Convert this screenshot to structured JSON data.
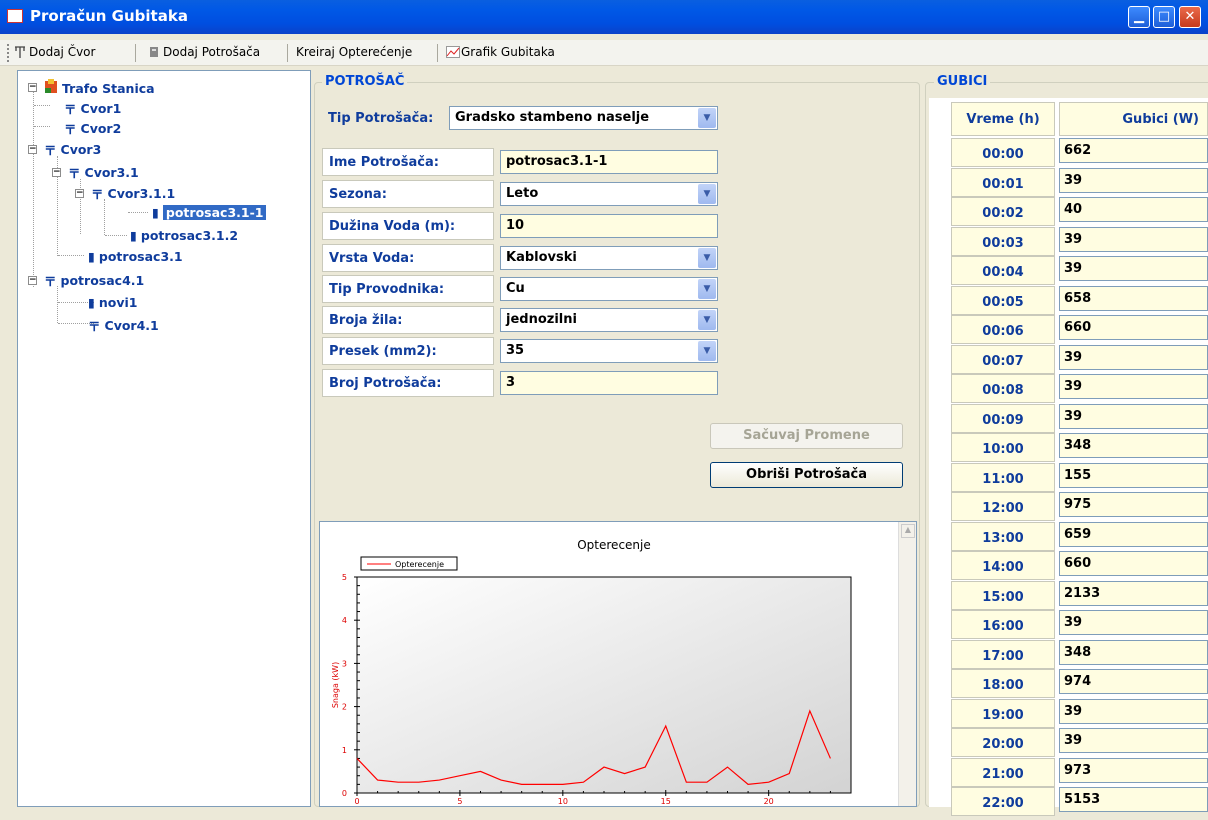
{
  "window": {
    "title": "Proračun Gubitaka"
  },
  "toolbar": {
    "add_node": "Dodaj Čvor",
    "add_consumer": "Dodaj Potrošača",
    "create_load": "Kreiraj Opterećenje",
    "loss_chart": "Grafik Gubitaka"
  },
  "tree": {
    "root": "Trafo Stanica",
    "cvor1": "Cvor1",
    "cvor2": "Cvor2",
    "cvor3": "Cvor3",
    "cvor31": "Cvor3.1",
    "cvor311": "Cvor3.1.1",
    "p3111": "potrosac3.1-1",
    "p312": "potrosac3.1.2",
    "p31": "potrosac3.1",
    "p41": "potrosac4.1",
    "novi1": "novi1",
    "cvor41": "Cvor4.1"
  },
  "consumer": {
    "group_title": "POTROŠAČ",
    "type_label": "Tip Potrošača:",
    "type_value": "Gradsko stambeno naselje",
    "fields": [
      {
        "label": "Ime Potrošača:",
        "value": "potrosac3.1-1"
      },
      {
        "label": "Sezona:",
        "value": "Leto"
      },
      {
        "label": "Dužina Voda (m):",
        "value": "10"
      },
      {
        "label": "Vrsta Voda:",
        "value": "Kablovski"
      },
      {
        "label": "Tip Provodnika:",
        "value": "Cu"
      },
      {
        "label": "Broja žila:",
        "value": "jednozilni"
      },
      {
        "label": "Presek (mm2):",
        "value": "35"
      },
      {
        "label": "Broj Potrošača:",
        "value": "3"
      }
    ],
    "save_button": "Sačuvaj Promene",
    "delete_button": "Obriši Potrošača"
  },
  "losses": {
    "group_title": "GUBICI",
    "col_time": "Vreme (h)",
    "col_loss": "Gubici (W)",
    "rows": [
      {
        "time": "00:00",
        "loss": "662"
      },
      {
        "time": "00:01",
        "loss": "39"
      },
      {
        "time": "00:02",
        "loss": "40"
      },
      {
        "time": "00:03",
        "loss": "39"
      },
      {
        "time": "00:04",
        "loss": "39"
      },
      {
        "time": "00:05",
        "loss": "658"
      },
      {
        "time": "00:06",
        "loss": "660"
      },
      {
        "time": "00:07",
        "loss": "39"
      },
      {
        "time": "00:08",
        "loss": "39"
      },
      {
        "time": "00:09",
        "loss": "39"
      },
      {
        "time": "10:00",
        "loss": "348"
      },
      {
        "time": "11:00",
        "loss": "155"
      },
      {
        "time": "12:00",
        "loss": "975"
      },
      {
        "time": "13:00",
        "loss": "659"
      },
      {
        "time": "14:00",
        "loss": "660"
      },
      {
        "time": "15:00",
        "loss": "2133"
      },
      {
        "time": "16:00",
        "loss": "39"
      },
      {
        "time": "17:00",
        "loss": "348"
      },
      {
        "time": "18:00",
        "loss": "974"
      },
      {
        "time": "19:00",
        "loss": "39"
      },
      {
        "time": "20:00",
        "loss": "39"
      },
      {
        "time": "21:00",
        "loss": "973"
      },
      {
        "time": "22:00",
        "loss": "5153"
      }
    ]
  },
  "chart_data": {
    "type": "line",
    "title": "Opterecenje",
    "ylabel": "Snaga (kW)",
    "xlabel": "",
    "xlim": [
      0,
      24
    ],
    "ylim": [
      0,
      5
    ],
    "x_ticks": [
      "0",
      "5",
      "10",
      "15",
      "20"
    ],
    "y_ticks": [
      "0",
      "1",
      "2",
      "3",
      "4",
      "5"
    ],
    "legend_position": "top-left",
    "series_color": "#ff0000",
    "series": [
      {
        "name": "Opterecenje",
        "x": [
          0,
          1,
          2,
          3,
          4,
          5,
          6,
          7,
          8,
          9,
          10,
          11,
          12,
          13,
          14,
          15,
          16,
          17,
          18,
          19,
          20,
          21,
          22,
          23
        ],
        "values": [
          0.8,
          0.3,
          0.25,
          0.25,
          0.3,
          0.4,
          0.5,
          0.3,
          0.2,
          0.2,
          0.2,
          0.25,
          0.6,
          0.45,
          0.6,
          1.55,
          0.25,
          0.25,
          0.6,
          0.2,
          0.25,
          0.45,
          1.9,
          0.8
        ]
      }
    ]
  }
}
